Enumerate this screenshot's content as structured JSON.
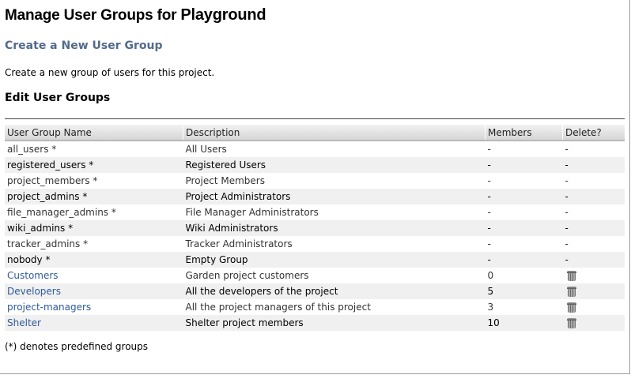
{
  "page": {
    "title_prefix": "Manage User Groups for ",
    "project_name": "Playground"
  },
  "create": {
    "link_label": "Create a New User Group",
    "description": "Create a new group of users for this project."
  },
  "edit": {
    "heading": "Edit User Groups"
  },
  "table": {
    "headers": [
      "User Group Name",
      "Description",
      "Members",
      "Delete?"
    ],
    "rows": [
      {
        "name": "all_users *",
        "description": "All Users",
        "members": "-",
        "delete": "-"
      },
      {
        "name": "registered_users *",
        "description": "Registered Users",
        "members": "-",
        "delete": "-"
      },
      {
        "name": "project_members *",
        "description": "Project Members",
        "members": "-",
        "delete": "-"
      },
      {
        "name": "project_admins *",
        "description": "Project Administrators",
        "members": "-",
        "delete": "-"
      },
      {
        "name": "file_manager_admins *",
        "description": "File Manager Administrators",
        "members": "-",
        "delete": "-"
      },
      {
        "name": "wiki_admins *",
        "description": "Wiki Administrators",
        "members": "-",
        "delete": "-"
      },
      {
        "name": "tracker_admins *",
        "description": "Tracker Administrators",
        "members": "-",
        "delete": "-"
      },
      {
        "name": "nobody *",
        "description": "Empty Group",
        "members": "-",
        "delete": "-"
      },
      {
        "name": "Customers",
        "description": "Garden project customers",
        "members": "0",
        "delete": "trash-icon"
      },
      {
        "name": "Developers",
        "description": "All the developers of the project",
        "members": "5",
        "delete": "trash-icon"
      },
      {
        "name": "project-managers",
        "description": "All the project managers of this project",
        "members": "3",
        "delete": "trash-icon"
      },
      {
        "name": "Shelter",
        "description": "Shelter project members",
        "members": "10",
        "delete": "trash-icon"
      }
    ]
  },
  "footnote": "(*) denotes predefined groups",
  "colors": {
    "link": "#2e5a9a",
    "create_link": "#536a8c",
    "row_alt": "#f0f0f0"
  }
}
